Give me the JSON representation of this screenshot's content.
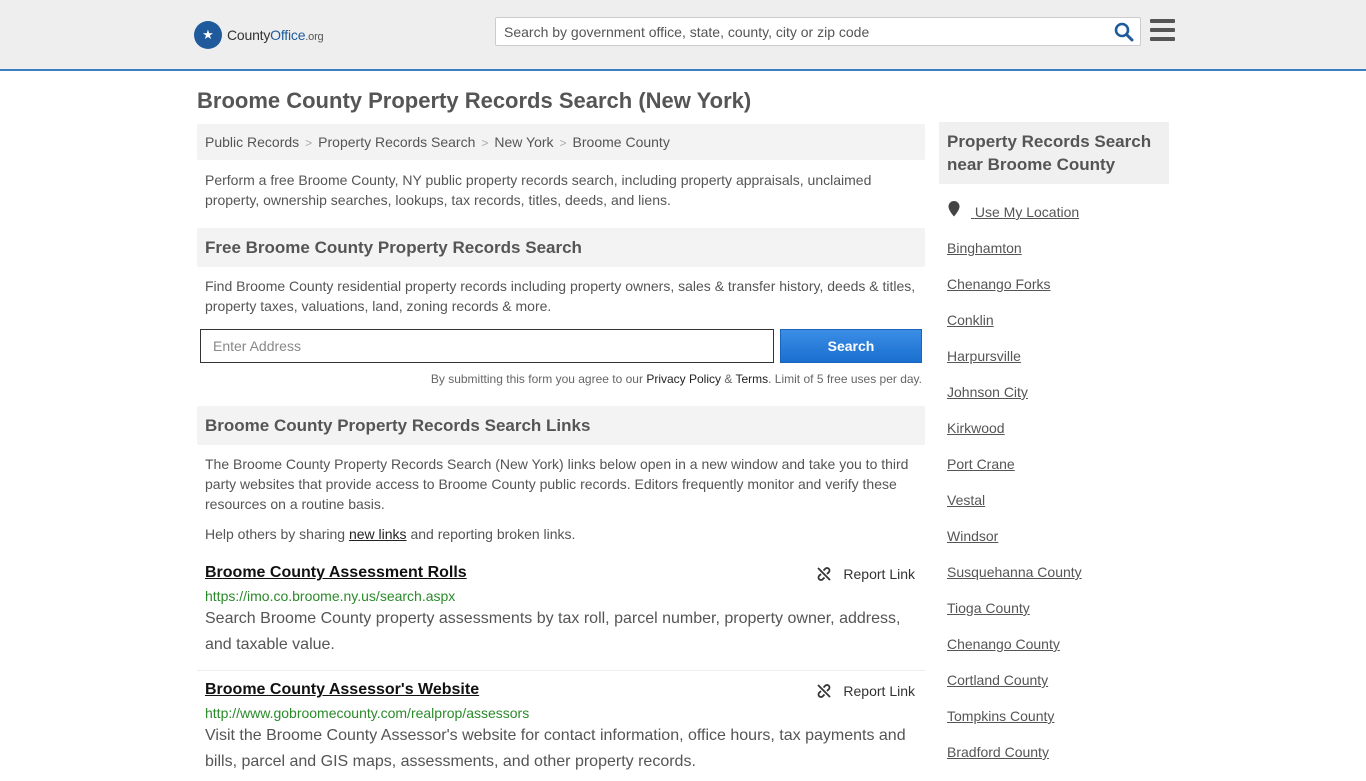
{
  "header": {
    "logo_text": "County",
    "logo_text_bold": "Office",
    "logo_suffix": ".org",
    "search_placeholder": "Search by government office, state, county, city or zip code"
  },
  "page_title": "Broome County Property Records Search (New York)",
  "breadcrumb": [
    "Public Records",
    "Property Records Search",
    "New York",
    "Broome County"
  ],
  "intro": "Perform a free Broome County, NY public property records search, including property appraisals, unclaimed property, ownership searches, lookups, tax records, titles, deeds, and liens.",
  "free_search": {
    "heading": "Free Broome County Property Records Search",
    "description": "Find Broome County residential property records including property owners, sales & transfer history, deeds & titles, property taxes, valuations, land, zoning records & more.",
    "address_placeholder": "Enter Address",
    "search_label": "Search",
    "terms_prefix": "By submitting this form you agree to our ",
    "privacy_label": "Privacy Policy",
    "amp": " & ",
    "terms_label": "Terms",
    "terms_suffix": ". Limit of 5 free uses per day."
  },
  "links_section": {
    "heading": "Broome County Property Records Search Links",
    "description": "The Broome County Property Records Search (New York) links below open in a new window and take you to third party websites that provide access to Broome County public records. Editors frequently monitor and verify these resources on a routine basis.",
    "share_prefix": "Help others by sharing ",
    "share_link": "new links",
    "share_suffix": " and reporting broken links.",
    "report_label": "Report Link",
    "items": [
      {
        "title": "Broome County Assessment Rolls",
        "url": "https://imo.co.broome.ny.us/search.aspx",
        "description": "Search Broome County property assessments by tax roll, parcel number, property owner, address, and taxable value."
      },
      {
        "title": "Broome County Assessor's Website",
        "url": "http://www.gobroomecounty.com/realprop/assessors",
        "description": "Visit the Broome County Assessor's website for contact information, office hours, tax payments and bills, parcel and GIS maps, assessments, and other property records."
      }
    ]
  },
  "sidebar": {
    "heading": "Property Records Search near Broome County",
    "use_location": "Use My Location",
    "places": [
      "Binghamton",
      "Chenango Forks",
      "Conklin",
      "Harpursville",
      "Johnson City",
      "Kirkwood",
      "Port Crane",
      "Vestal",
      "Windsor",
      "Susquehanna County",
      "Tioga County",
      "Chenango County",
      "Cortland County",
      "Tompkins County",
      "Bradford County"
    ]
  },
  "colors": {
    "accent": "#3a7fc4",
    "button": "#1b6fcf",
    "url_green": "#2a8a2a"
  }
}
